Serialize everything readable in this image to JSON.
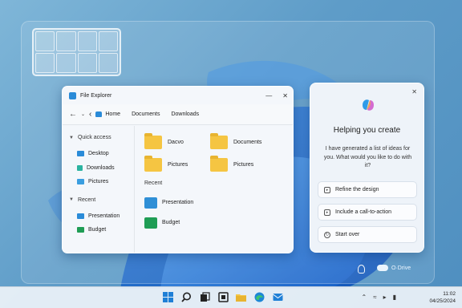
{
  "explorer": {
    "title": "File Explorer",
    "breadcrumbs": [
      "Home",
      "Documents",
      "Downloads"
    ],
    "sidebar": {
      "quick_access_label": "Quick access",
      "quick_access": [
        "Desktop",
        "Downloads",
        "Pictures"
      ],
      "recent_label": "Recent",
      "recent": [
        "Presentation",
        "Budget"
      ]
    },
    "folders": [
      "Dacvo",
      "Documents",
      "Pictures",
      "Pictures"
    ],
    "recent_label": "Recent",
    "recent_files": [
      "Presentation",
      "Budget"
    ]
  },
  "copilot": {
    "heading": "Helping you create",
    "message": "I have generated a list of ideas for you. What would you like to do with it?",
    "suggestions": [
      "Refine the design",
      "Include a call-to-action",
      "Start over"
    ]
  },
  "onedrive_label": "O·Drive",
  "clock": {
    "time": "11:02",
    "date": "04/25/2024"
  },
  "icons": {
    "start": "windows-start-icon",
    "search": "search-icon",
    "taskview": "task-view-icon",
    "folder": "file-explorer-icon",
    "edge": "edge-icon",
    "mail": "mail-icon"
  },
  "colors": {
    "accent": "#2a8bd8",
    "folder": "#f5c542"
  }
}
